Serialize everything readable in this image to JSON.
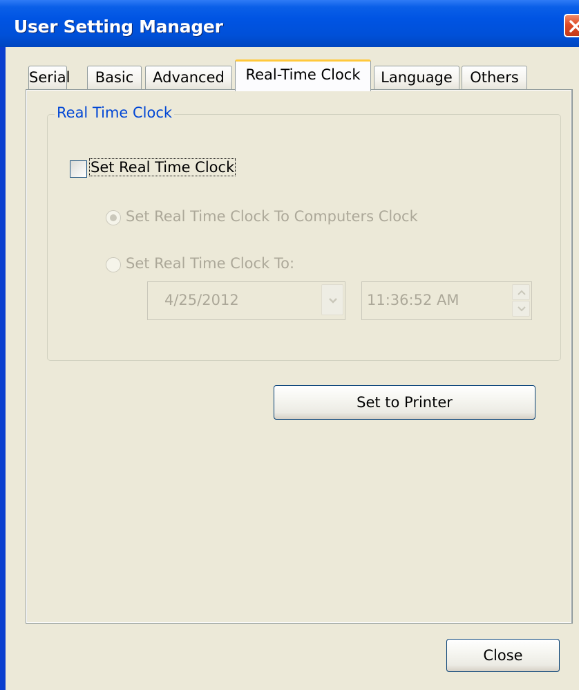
{
  "window": {
    "title": "User Setting Manager"
  },
  "tabs": [
    {
      "label": "Serial"
    },
    {
      "label": "Basic"
    },
    {
      "label": "Advanced"
    },
    {
      "label": "Real-Time Clock"
    },
    {
      "label": "Language"
    },
    {
      "label": "Others"
    }
  ],
  "active_tab": "Real-Time Clock",
  "rtc": {
    "group_title": "Real Time Clock",
    "checkbox_label": "Set Real Time Clock",
    "checkbox_checked": false,
    "radio_computer_label": "Set Real Time Clock To Computers Clock",
    "radio_computer_selected": true,
    "radio_custom_label": "Set Real Time Clock To:",
    "radio_custom_selected": false,
    "date_value": "4/25/2012",
    "time_value": "11:36:52 AM",
    "set_button_label": "Set to Printer"
  },
  "footer": {
    "close_label": "Close"
  },
  "colors": {
    "title_bar": "#0054e3",
    "dialog_bg": "#ece9d8",
    "group_title": "#0046d5",
    "disabled_text": "#aca899",
    "active_tab_highlight": "#ffc83c"
  },
  "icons": {
    "title_close": "close-icon",
    "date_dropdown": "chevron-down-icon",
    "time_up": "spin-up-icon",
    "time_down": "spin-down-icon"
  }
}
